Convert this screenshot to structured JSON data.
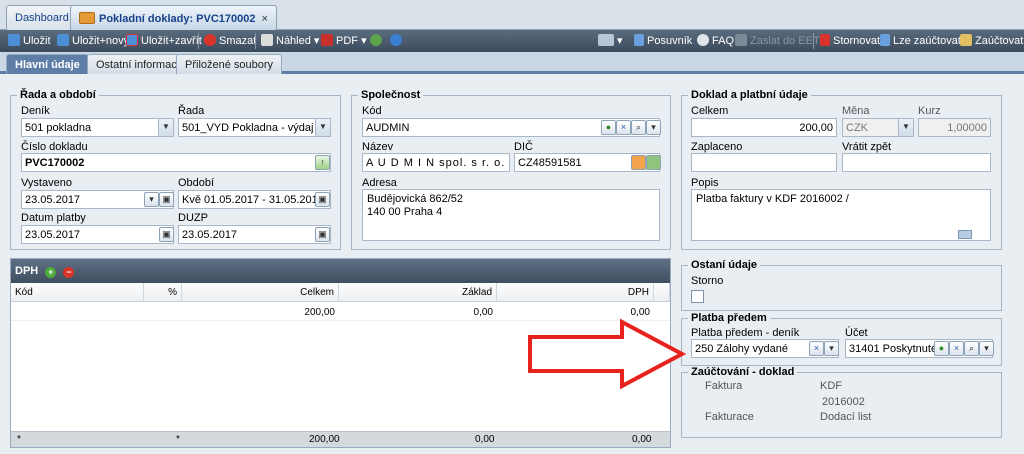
{
  "tabs": {
    "dashboard": "Dashboard",
    "active": "Pokladní doklady: PVC170002",
    "close": "×"
  },
  "toolbar": {
    "save": "Uložit",
    "save_new": "Uložit+nový",
    "save_close": "Uložit+zavřít",
    "delete": "Smazat",
    "preview": "Náhled",
    "pdf": "PDF",
    "slider": "Posuvník",
    "faq": "FAQ",
    "send_eet": "Zaslat do EET",
    "cancel": "Stornovat",
    "can_post": "Lze zaúčtovat",
    "post": "Zaúčtovat",
    "dd_arrow": "▾"
  },
  "subtabs": [
    "Hlavní údaje",
    "Ostatní informace",
    "Přiložené soubory"
  ],
  "rada": {
    "legend": "Řada a období",
    "denik_label": "Deník",
    "denik_value": "501 pokladna",
    "rada_label": "Řada",
    "rada_value": "501_VYD Pokladna - výdaj -",
    "cislo_label": "Číslo dokladu",
    "cislo_value": "PVC170002",
    "vystaveno_label": "Vystaveno",
    "vystaveno_value": "23.05.2017",
    "obdobi_label": "Období",
    "obdobi_value": "Kvě 01.05.2017 - 31.05.201",
    "datum_label": "Datum platby",
    "datum_value": "23.05.2017",
    "duzp_label": "DUZP",
    "duzp_value": "23.05.2017"
  },
  "spolecnost": {
    "legend": "Společnost",
    "kod_label": "Kód",
    "kod_value": "AUDMIN",
    "nazev_label": "Název",
    "nazev_value": "A U D M I N  spol. s r. o.",
    "dic_label": "DIČ",
    "dic_value": "CZ48591581",
    "adresa_label": "Adresa",
    "adresa_line1": "Budějovická 862/52",
    "adresa_line2": "140 00 Praha 4"
  },
  "doklad": {
    "legend": "Doklad a platbní údaje",
    "celkem_label": "Celkem",
    "celkem_value": "200,00",
    "mena_label": "Měna",
    "mena_value": "CZK",
    "kurz_label": "Kurz",
    "kurz_value": "1,00000",
    "zaplaceno_label": "Zaplaceno",
    "vratit_label": "Vrátit zpět",
    "popis_label": "Popis",
    "popis_value": "Platba faktury v KDF 2016002 /"
  },
  "ostatni": {
    "legend": "Ostaní údaje",
    "storno_label": "Storno"
  },
  "platba": {
    "legend": "Platba předem",
    "denik_label": "Platba předem - deník",
    "denik_value": "250 Zálohy vydané",
    "ucet_label": "Účet",
    "ucet_value": "31401 Poskytnuté"
  },
  "zauct": {
    "legend": "Zaúčtování - doklad",
    "faktura_label": "Faktura",
    "faktura_value1": "KDF",
    "faktura_value2": "2016002",
    "fakturace_label": "Fakturace",
    "fakturace_value": "Dodací list"
  },
  "dph": {
    "title": "DPH",
    "columns": [
      "Kód",
      "%",
      "Celkem",
      "Základ",
      "DPH"
    ],
    "row": {
      "celkem": "200,00",
      "zaklad": "0,00",
      "dph": "0,00"
    },
    "footer": {
      "kod": "*",
      "pct": "*",
      "celkem": "200,00",
      "zaklad": "0,00",
      "dph": "0,00"
    }
  }
}
